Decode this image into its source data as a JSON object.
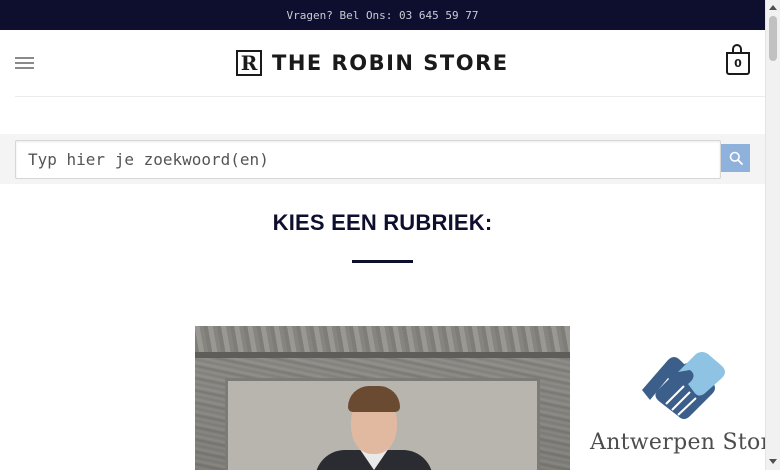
{
  "topbar": {
    "text": "Vragen? Bel Ons: 03 645 59 77"
  },
  "header": {
    "menu_icon": "hamburger-menu-icon",
    "logo": {
      "mark": "R",
      "text": "THE ROBIN STORE"
    },
    "cart": {
      "icon": "shopping-bag-icon",
      "count": "0"
    }
  },
  "search": {
    "placeholder": "Typ hier je zoekwoord(en)",
    "button_icon": "search-icon"
  },
  "main": {
    "section_title": "KIES EEN RUBRIEK:",
    "category_image": "photo of young man in suit in front of stone wall"
  },
  "badge": {
    "icon": "handshake-icon",
    "name": "Antwerpen Store"
  },
  "colors": {
    "topbar_bg": "#0e0f2e",
    "heading": "#0e0f2e",
    "search_button": "#8fb2dc",
    "handshake_dark": "#3b5f8a",
    "handshake_light": "#8fc3e3"
  }
}
